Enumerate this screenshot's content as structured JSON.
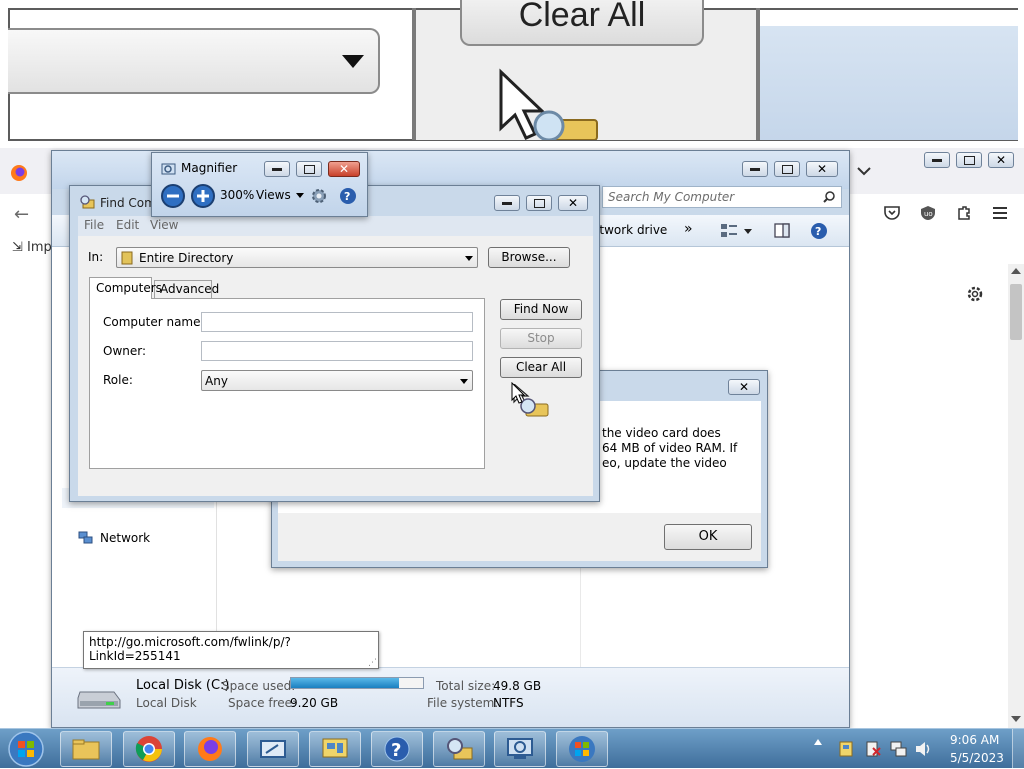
{
  "zoom": {
    "clear_all_label": "Clear All"
  },
  "browser": {
    "bookmark_label": "Imp"
  },
  "explorer": {
    "search_placeholder": "Search My Computer",
    "toolbar_item": "etwork drive",
    "more_symbol": "»",
    "nav_network": "Network",
    "status": {
      "disk_name": "Local Disk (C:)",
      "disk_type": "Local Disk",
      "space_used_label": "Space used:",
      "space_used_fraction": 0.82,
      "space_free_label": "Space free:",
      "space_free_value": "9.20 GB",
      "total_size_label": "Total size:",
      "total_size_value": "49.8 GB",
      "fs_label": "File system:",
      "fs_value": "NTFS"
    },
    "tooltip_url": "http://go.microsoft.com/fwlink/p/?LinkId=255141"
  },
  "magnifier": {
    "title": "Magnifier",
    "zoom_level": "300%",
    "views_label": "Views"
  },
  "find": {
    "title": "Find Com",
    "menu": [
      "File",
      "Edit",
      "View"
    ],
    "in_label": "In:",
    "in_value": "Entire Directory",
    "browse_label": "Browse...",
    "tabs": [
      "Computers",
      "Advanced"
    ],
    "computer_name_label": "Computer name:",
    "owner_label": "Owner:",
    "role_label": "Role:",
    "role_value": "Any",
    "find_now_label": "Find Now",
    "stop_label": "Stop",
    "clear_all_label": "Clear All"
  },
  "dialog": {
    "text_lines": [
      "the video card does",
      "64 MB of video RAM. If",
      "eo, update the video"
    ],
    "ok_label": "OK"
  },
  "taskbar": {
    "time": "9:06 AM",
    "date": "5/5/2023"
  }
}
